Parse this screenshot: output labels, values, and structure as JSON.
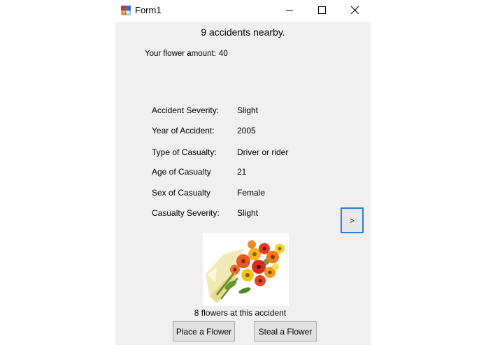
{
  "window": {
    "title": "Form1",
    "controls": {
      "minimize_icon": "minimize-icon",
      "maximize_icon": "maximize-icon",
      "close_icon": "close-icon"
    }
  },
  "header": {
    "accidents_nearby": "9 accidents nearby."
  },
  "flower_amount": {
    "label": "Your flower amount:",
    "value": "40"
  },
  "accident_details": [
    {
      "label": "Accident Severity:",
      "value": "Slight"
    },
    {
      "label": "Year of Accident:",
      "value": "2005"
    },
    {
      "label": "Type of Casualty:",
      "value": "Driver or rider"
    },
    {
      "label": "Age of Casualty",
      "value": "21"
    },
    {
      "label": "Sex of Casualty",
      "value": "Female"
    },
    {
      "label": "Casualty Severity:",
      "value": "Slight"
    }
  ],
  "navigation": {
    "next_label": ">"
  },
  "flowers_at_accident": "8 flowers at this accident",
  "actions": {
    "place_label": "Place a Flower",
    "steal_label": "Steal a Flower"
  },
  "colors": {
    "client_background": "#f0f0f0",
    "accent_border": "#2d7dd2",
    "button_face": "#e1e1e1"
  }
}
